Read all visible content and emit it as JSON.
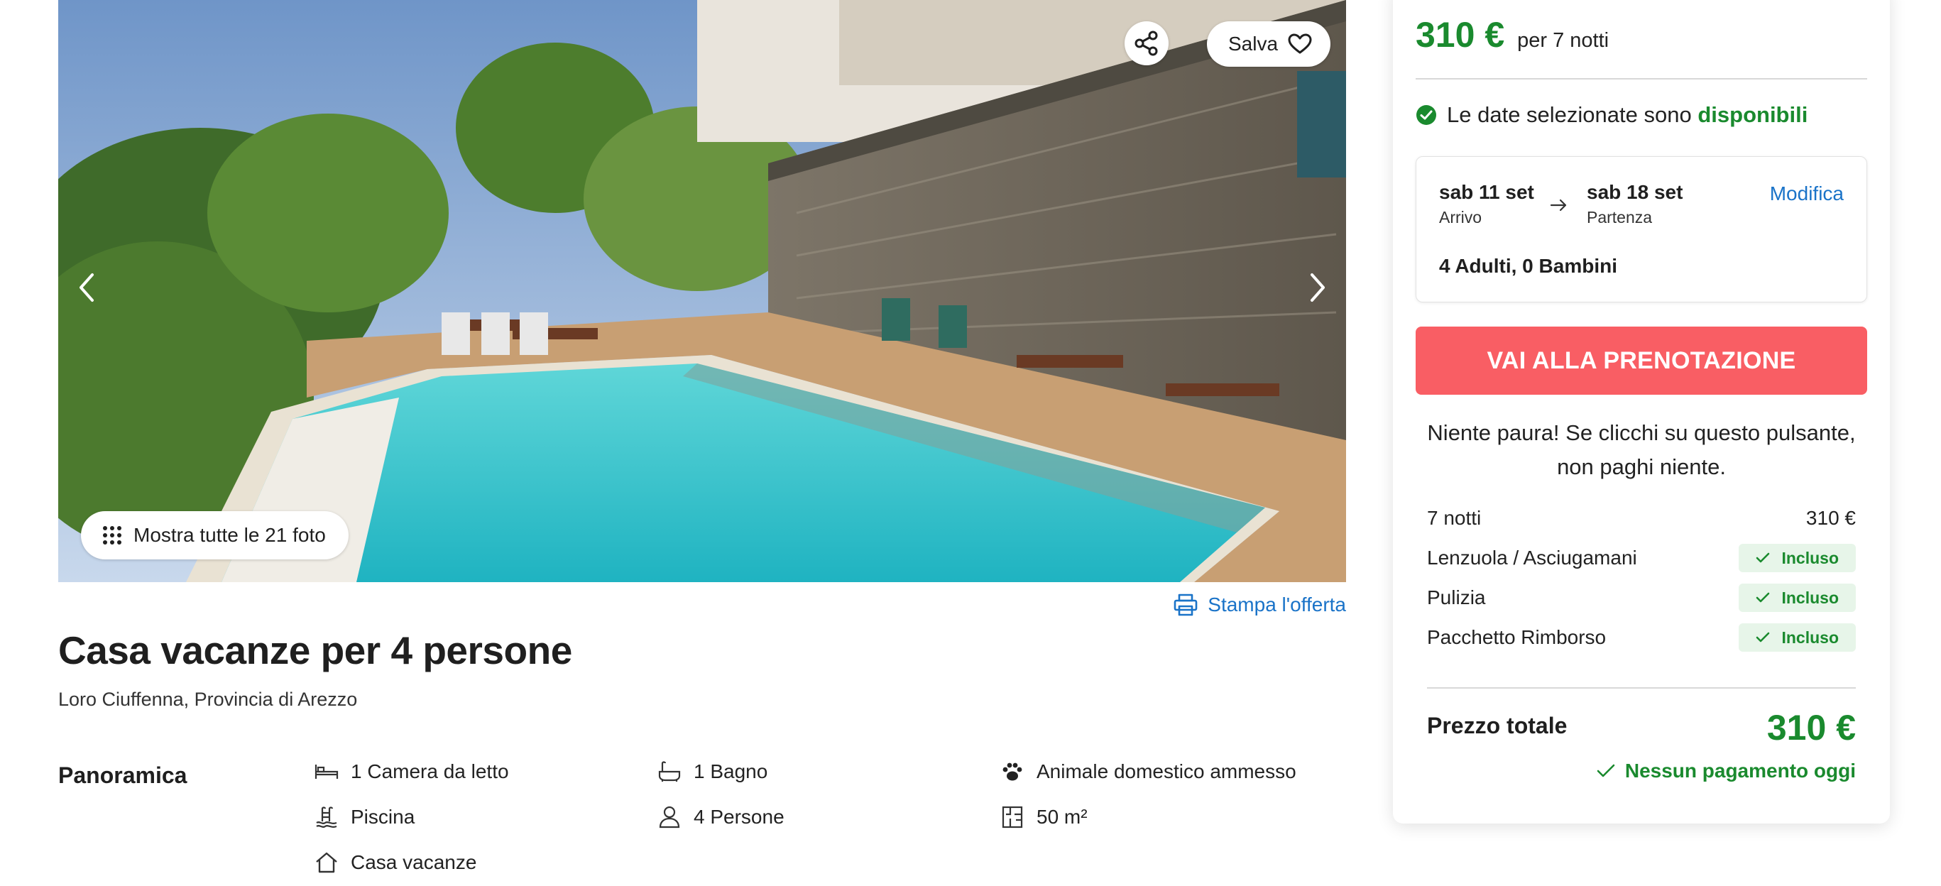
{
  "gallery": {
    "save_label": "Salva",
    "show_all_label": "Mostra tutte le 21 foto"
  },
  "listing": {
    "print_label": "Stampa l'offerta",
    "title": "Casa vacanze per 4 persone",
    "location": "Loro Ciuffenna, Provincia di Arezzo"
  },
  "overview": {
    "label": "Panoramica",
    "features": [
      {
        "text": "1 Camera da letto",
        "icon": "bed-icon"
      },
      {
        "text": "1 Bagno",
        "icon": "bathtub-icon"
      },
      {
        "text": "Animale domestico ammesso",
        "icon": "paw-icon"
      },
      {
        "text": "Piscina",
        "icon": "pool-icon"
      },
      {
        "text": "4 Persone",
        "icon": "person-icon"
      },
      {
        "text": "50 m²",
        "icon": "floorplan-icon"
      },
      {
        "text": "Casa vacanze",
        "icon": "house-icon"
      }
    ]
  },
  "booking": {
    "price": "310 €",
    "nights_label": "per 7 notti",
    "availability_text": "Le date selezionate sono",
    "availability_status": "disponibili",
    "checkin_date": "sab 11 set",
    "checkin_label": "Arrivo",
    "checkout_date": "sab 18 set",
    "checkout_label": "Partenza",
    "modify_label": "Modifica",
    "guests": "4 Adulti, 0 Bambini",
    "cta_label": "VAI ALLA PRENOTAZIONE",
    "reassurance": "Niente paura! Se clicchi su questo pulsante, non paghi niente.",
    "line_items": [
      {
        "label": "7 notti",
        "value": "310 €"
      },
      {
        "label": "Lenzuola / Asciugamani",
        "value": "Incluso"
      },
      {
        "label": "Pulizia",
        "value": "Incluso"
      },
      {
        "label": "Pacchetto Rimborso",
        "value": "Incluso"
      }
    ],
    "total_label": "Prezzo totale",
    "total_value": "310 €",
    "no_payment_label": "Nessun pagamento oggi"
  },
  "colors": {
    "green": "#1a8a2e",
    "cta": "#f95e64",
    "link": "#1a73c8"
  }
}
